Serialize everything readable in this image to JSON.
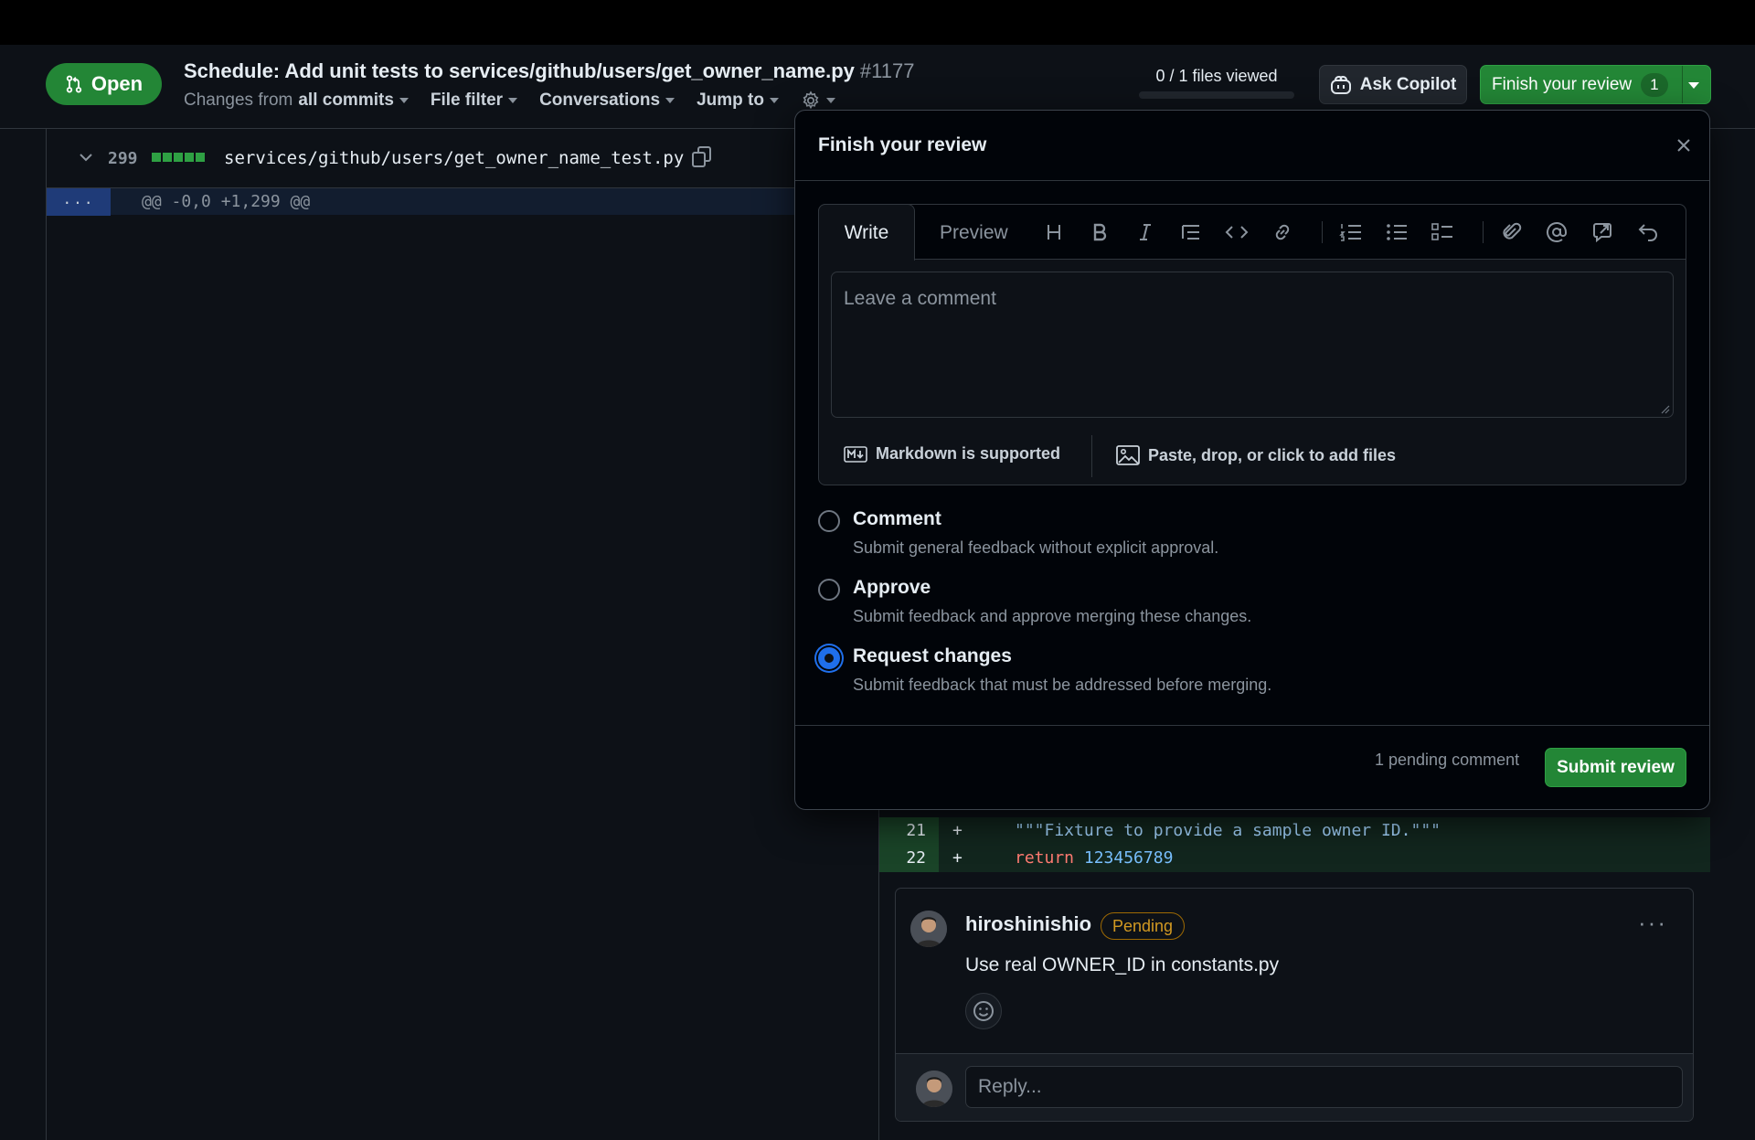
{
  "header": {
    "state_badge": "Open",
    "title": "Schedule: Add unit tests to services/github/users/get_owner_name.py",
    "pr_number": "#1177",
    "changes_prefix": "Changes from",
    "changes_value": "all commits",
    "file_filter": "File filter",
    "conversations": "Conversations",
    "jump_to": "Jump to",
    "files_viewed": "0 / 1 files viewed",
    "files_viewed_progress": 0,
    "ask_copilot": "Ask Copilot",
    "finish_review": "Finish your review",
    "finish_review_count": "1"
  },
  "file": {
    "line_count": "299",
    "path": "services/github/users/get_owner_name_test.py",
    "hunk_expand": "...",
    "hunk_header": "@@ -0,0 +1,299 @@",
    "lines": [
      {
        "num": "21",
        "sign": "+",
        "code_string": "\"\"\"Fixture to provide a sample owner ID.\"\"\""
      },
      {
        "num": "22",
        "sign": "+",
        "code_keyword": "return",
        "code_number": "123456789"
      }
    ]
  },
  "comment": {
    "author": "hiroshinishio",
    "badge": "Pending",
    "more": "···",
    "body": "Use real OWNER_ID in constants.py",
    "reply_placeholder": "Reply..."
  },
  "review_popover": {
    "title": "Finish your review",
    "tabs": {
      "write": "Write",
      "preview": "Preview"
    },
    "toolbar": [
      "heading-icon",
      "bold-icon",
      "italic-icon",
      "quote-icon",
      "code-icon",
      "link-icon",
      "ordered-list-icon",
      "unordered-list-icon",
      "task-list-icon",
      "attach-icon",
      "mention-icon",
      "reference-icon",
      "undo-icon"
    ],
    "textarea_placeholder": "Leave a comment",
    "markdown_note": "Markdown is supported",
    "attach_note": "Paste, drop, or click to add files",
    "options": [
      {
        "label": "Comment",
        "description": "Submit general feedback without explicit approval.",
        "checked": false
      },
      {
        "label": "Approve",
        "description": "Submit feedback and approve merging these changes.",
        "checked": false
      },
      {
        "label": "Request changes",
        "description": "Submit feedback that must be addressed before merging.",
        "checked": true
      }
    ],
    "pending_comment": "1 pending comment",
    "submit": "Submit review"
  },
  "colors": {
    "accent_green": "#238636",
    "focus_blue": "#1f6feb",
    "pending_orange": "#d29922"
  }
}
